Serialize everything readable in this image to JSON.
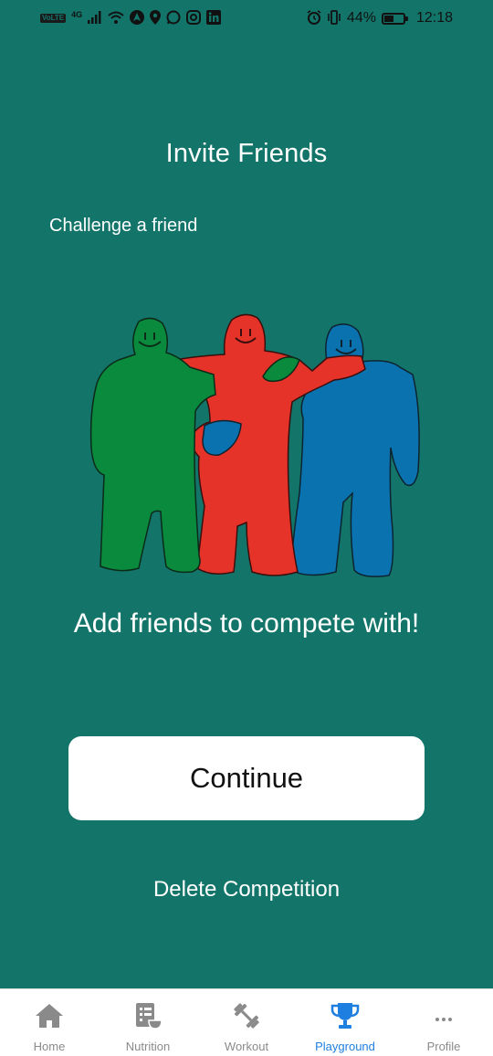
{
  "status_bar": {
    "left_icons": [
      "volte-icon",
      "4g-icon",
      "signal-icon",
      "wifi-icon",
      "navigation-app-icon",
      "location-icon",
      "whatsapp-icon",
      "instagram-icon",
      "linkedin-icon"
    ],
    "network_label": "4G",
    "volte_label": "VoLTE",
    "battery_percent": "44%",
    "time": "12:18"
  },
  "page": {
    "title": "Invite Friends",
    "subtitle": "Challenge a friend",
    "tagline": "Add friends to compete with!",
    "continue_label": "Continue",
    "delete_label": "Delete Competition"
  },
  "illustration": {
    "icon": "friends-hugging-illustration",
    "colors": {
      "green": "#0a8a3c",
      "red": "#e5332a",
      "blue": "#0b72b0"
    }
  },
  "tab_bar": {
    "active_color": "#1f7fe0",
    "inactive_color": "#8a8a8a",
    "tabs": [
      {
        "label": "Home",
        "icon": "home-icon",
        "active": false
      },
      {
        "label": "Nutrition",
        "icon": "nutrition-icon",
        "active": false
      },
      {
        "label": "Workout",
        "icon": "dumbbell-icon",
        "active": false
      },
      {
        "label": "Playground",
        "icon": "trophy-icon",
        "active": true
      },
      {
        "label": "Profile",
        "icon": "more-dots-icon",
        "active": false
      }
    ]
  },
  "colors": {
    "background": "#13756a",
    "button_bg": "#ffffff",
    "button_text": "#111111"
  }
}
